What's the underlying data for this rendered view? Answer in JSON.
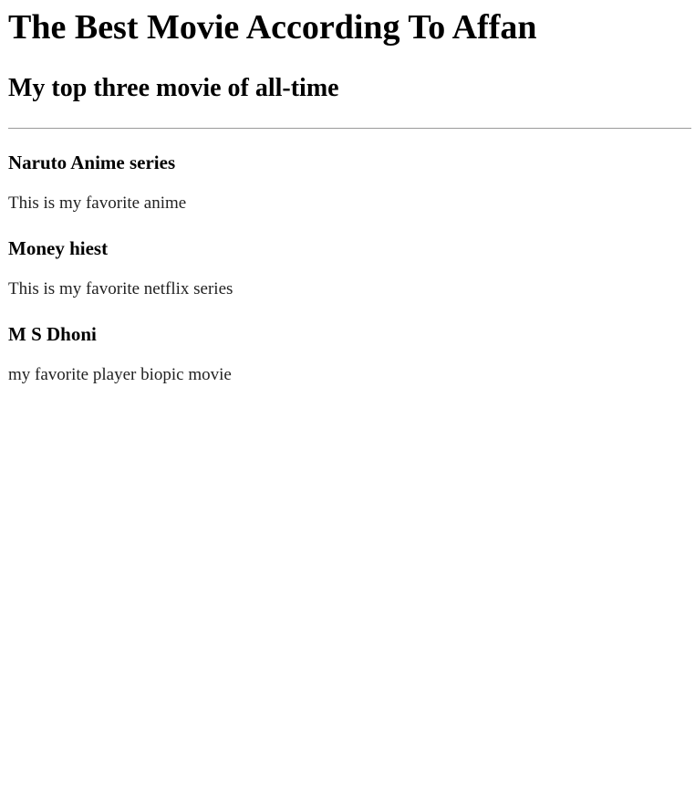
{
  "page": {
    "title": "The Best Movie According To Affan",
    "subtitle": "My top three movie of all-time"
  },
  "movies": [
    {
      "name": "Naruto Anime series",
      "description": "This is my favorite anime"
    },
    {
      "name": "Money hiest",
      "description": "This is my favorite netflix series"
    },
    {
      "name": "M S Dhoni",
      "description": "my favorite player biopic movie"
    }
  ]
}
